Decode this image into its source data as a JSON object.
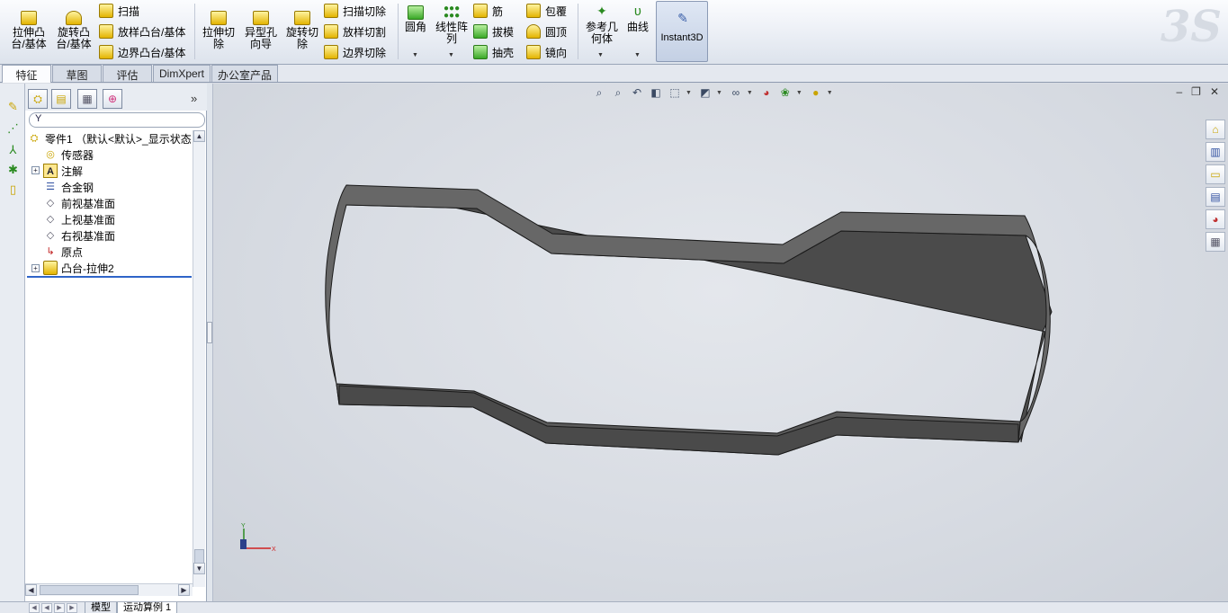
{
  "ribbon": {
    "features": {
      "extrude_boss": "拉伸凸\n台/基体",
      "revolve_boss": "旋转凸\n台/基体",
      "sweep": "扫描",
      "loft_boss": "放样凸台/基体",
      "boundary_boss": "边界凸台/基体",
      "extrude_cut": "拉伸切\n除",
      "hole_wizard": "异型孔\n向导",
      "revolve_cut": "旋转切\n除",
      "swept_cut": "扫描切除",
      "lofted_cut": "放样切割",
      "boundary_cut": "边界切除",
      "fillet": "圆角",
      "linear_pattern": "线性阵\n列",
      "rib": "筋",
      "draft": "拔模",
      "shell": "抽壳",
      "wrap": "包覆",
      "dome": "圆顶",
      "mirror": "镜向",
      "ref_geometry": "参考几\n何体",
      "curves": "曲线",
      "instant3d": "Instant3D"
    },
    "logo": "3S"
  },
  "tabs": [
    "特征",
    "草图",
    "评估",
    "DimXpert",
    "办公室产品"
  ],
  "active_tab": "特征",
  "feature_tree": {
    "root": "零件1 （默认<默认>_显示状态",
    "items": [
      {
        "label": "传感器",
        "icon": "sensor-icon"
      },
      {
        "label": "注解",
        "icon": "annotation-icon"
      },
      {
        "label": "合金钢",
        "icon": "material-icon"
      },
      {
        "label": "前视基准面",
        "icon": "plane-icon"
      },
      {
        "label": "上视基准面",
        "icon": "plane-icon"
      },
      {
        "label": "右视基准面",
        "icon": "plane-icon"
      },
      {
        "label": "原点",
        "icon": "origin-icon"
      },
      {
        "label": "凸台-拉伸2",
        "icon": "extrude-feature-icon"
      }
    ],
    "expand_glyph": "+",
    "more_glyph": "»",
    "filter_glyph": "Y"
  },
  "bottom_tabs": [
    "模型",
    "运动算例 1"
  ],
  "triad": {
    "x": "X",
    "y": "Y"
  },
  "window_controls": {
    "minimize": "–",
    "restore": "❐",
    "close": "✕"
  },
  "colors": {
    "ribbon_bg": "#e9edf4",
    "viewport_bg": "#d9dde3",
    "part_top": "#6a6a6a",
    "part_side": "#4b4b4b",
    "active_button": "#c4d0e4"
  }
}
